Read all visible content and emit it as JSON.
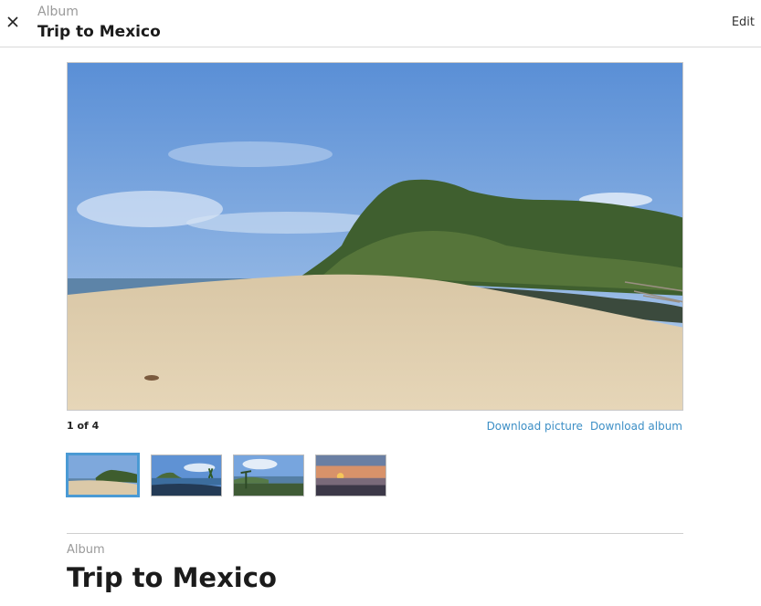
{
  "header": {
    "close_icon": "close-icon",
    "label": "Album",
    "title": "Trip to Mexico",
    "edit_label": "Edit"
  },
  "viewer": {
    "counter": "1 of 4",
    "download_picture": "Download picture",
    "download_album": "Download album"
  },
  "thumbnails": [
    {
      "scene": "beach-headland",
      "selected": true
    },
    {
      "scene": "beach-island",
      "selected": false
    },
    {
      "scene": "bay-palms",
      "selected": false
    },
    {
      "scene": "sunset",
      "selected": false
    }
  ],
  "section": {
    "label": "Album",
    "title": "Trip to Mexico"
  },
  "colors": {
    "accent": "#4a9ad4",
    "link": "#3d8fc6"
  }
}
